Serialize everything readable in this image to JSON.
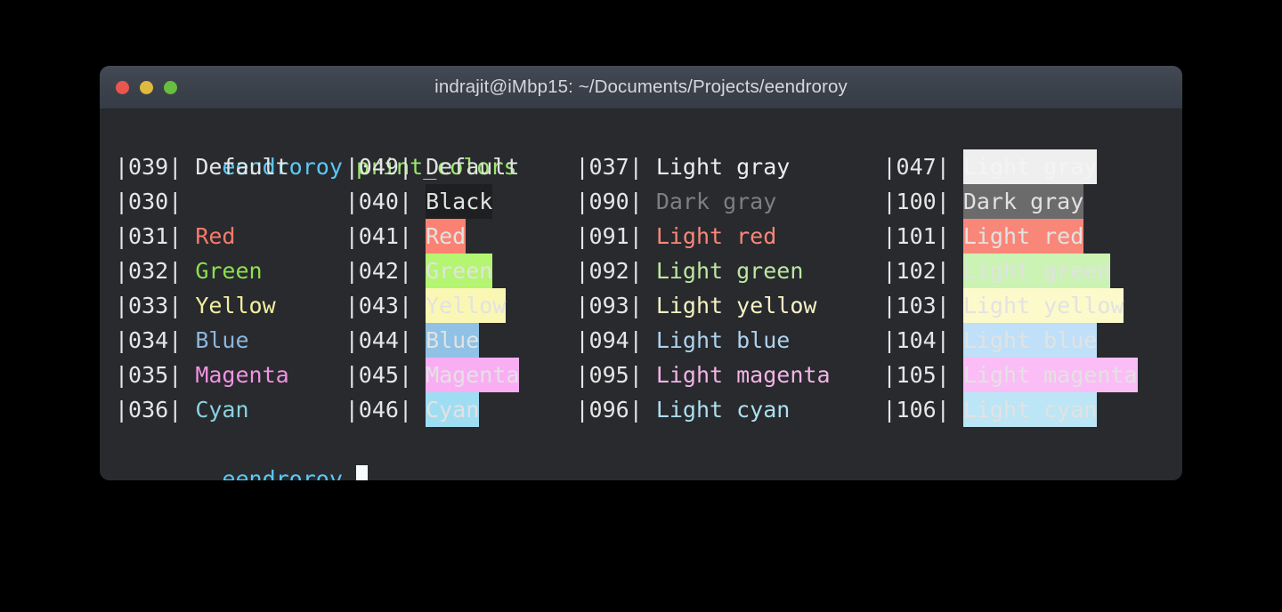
{
  "window": {
    "title": "indrajit@iMbp15: ~/Documents/Projects/eendroroy",
    "traffic_lights": {
      "close": "close-button",
      "minimize": "minimize-button",
      "maximize": "maximize-button"
    },
    "colors": {
      "titlebar_bg": "#3C424C",
      "terminal_bg": "#282A2E",
      "close": "#E8564E",
      "minimize": "#E0B93F",
      "maximize": "#68BE3D"
    }
  },
  "command_line": {
    "user": "eendroroy",
    "command": "print_colors"
  },
  "prompt_line": {
    "user": "eendroroy",
    "cursor": "█"
  },
  "table": {
    "columns": [
      {
        "name": "foreground-standard",
        "rows": [
          {
            "code": "|039|",
            "label": "Default",
            "fg": "fg-default",
            "bg": null
          },
          {
            "code": "|030|",
            "label": "",
            "fg": "fg-black",
            "bg": null
          },
          {
            "code": "|031|",
            "label": "Red",
            "fg": "fg-red",
            "bg": null
          },
          {
            "code": "|032|",
            "label": "Green",
            "fg": "fg-green",
            "bg": null
          },
          {
            "code": "|033|",
            "label": "Yellow",
            "fg": "fg-yellow",
            "bg": null
          },
          {
            "code": "|034|",
            "label": "Blue",
            "fg": "fg-blue",
            "bg": null
          },
          {
            "code": "|035|",
            "label": "Magenta",
            "fg": "fg-magenta",
            "bg": null
          },
          {
            "code": "|036|",
            "label": "Cyan",
            "fg": "fg-cyan",
            "bg": null
          }
        ]
      },
      {
        "name": "background-standard",
        "rows": [
          {
            "code": "|049|",
            "label": "Default",
            "fg": null,
            "bg": "bg-default"
          },
          {
            "code": "|040|",
            "label": "Black",
            "fg": null,
            "bg": "bg-black"
          },
          {
            "code": "|041|",
            "label": "Red",
            "fg": null,
            "bg": "bg-red"
          },
          {
            "code": "|042|",
            "label": "Green",
            "fg": null,
            "bg": "bg-green"
          },
          {
            "code": "|043|",
            "label": "Yellow",
            "fg": null,
            "bg": "bg-yellow"
          },
          {
            "code": "|044|",
            "label": "Blue",
            "fg": null,
            "bg": "bg-blue"
          },
          {
            "code": "|045|",
            "label": "Magenta",
            "fg": null,
            "bg": "bg-magenta"
          },
          {
            "code": "|046|",
            "label": "Cyan",
            "fg": null,
            "bg": "bg-cyan"
          }
        ]
      },
      {
        "name": "foreground-light",
        "rows": [
          {
            "code": "|037|",
            "label": "Light gray",
            "fg": "fg-lightgray",
            "bg": null
          },
          {
            "code": "|090|",
            "label": "Dark gray",
            "fg": "fg-darkgray",
            "bg": null
          },
          {
            "code": "|091|",
            "label": "Light red",
            "fg": "fg-lightred",
            "bg": null
          },
          {
            "code": "|092|",
            "label": "Light green",
            "fg": "fg-lightgreen",
            "bg": null
          },
          {
            "code": "|093|",
            "label": "Light yellow",
            "fg": "fg-lightyellow",
            "bg": null
          },
          {
            "code": "|094|",
            "label": "Light blue",
            "fg": "fg-lightblue",
            "bg": null
          },
          {
            "code": "|095|",
            "label": "Light magenta",
            "fg": "fg-lightmagenta",
            "bg": null
          },
          {
            "code": "|096|",
            "label": "Light cyan",
            "fg": "fg-lightcyan",
            "bg": null
          }
        ]
      },
      {
        "name": "background-light",
        "rows": [
          {
            "code": "|047|",
            "label": "Light gray",
            "fg": null,
            "bg": "bg-lightgray"
          },
          {
            "code": "|100|",
            "label": "Dark gray",
            "fg": null,
            "bg": "bg-darkgray"
          },
          {
            "code": "|101|",
            "label": "Light red",
            "fg": null,
            "bg": "bg-lightred"
          },
          {
            "code": "|102|",
            "label": "Light green",
            "fg": null,
            "bg": "bg-lightgreen"
          },
          {
            "code": "|103|",
            "label": "Light yellow",
            "fg": null,
            "bg": "bg-lightyellow"
          },
          {
            "code": "|104|",
            "label": "Light blue",
            "fg": null,
            "bg": "bg-lightblue"
          },
          {
            "code": "|105|",
            "label": "Light magenta",
            "fg": null,
            "bg": "bg-lightmagenta"
          },
          {
            "code": "|106|",
            "label": "Light cyan",
            "fg": null,
            "bg": "bg-lightcyan"
          }
        ]
      }
    ]
  }
}
